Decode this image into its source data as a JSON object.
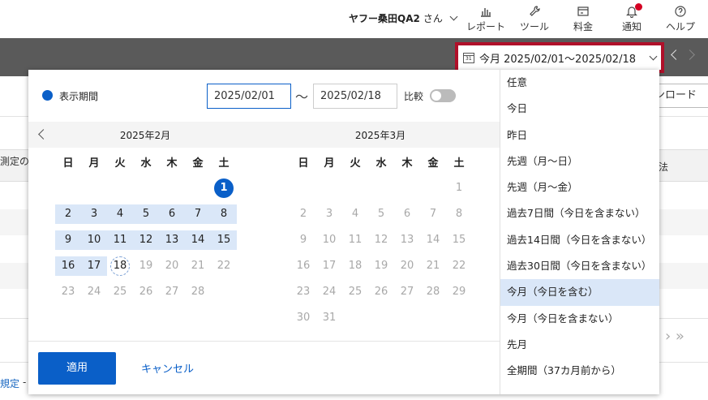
{
  "header": {
    "username": "ヤフー桑田QA2",
    "username_suffix": "さん",
    "nav": [
      {
        "label": "レポート",
        "icon": "bar-chart-icon"
      },
      {
        "label": "ツール",
        "icon": "wrench-icon"
      },
      {
        "label": "料金",
        "icon": "billing-icon"
      },
      {
        "label": "通知",
        "icon": "bell-icon"
      },
      {
        "label": "ヘルプ",
        "icon": "help-icon"
      }
    ]
  },
  "toolbar": {
    "date_range_label": "今月 2025/02/01〜2025/02/18"
  },
  "background": {
    "download_label": "ンロード",
    "column_left": "測定の時",
    "column_right": "法",
    "footer_link": "規定",
    "footer_dash": "-"
  },
  "datepicker": {
    "period_label": "表示期間",
    "start_date": "2025/02/01",
    "end_date": "2025/02/18",
    "range_separator": "〜",
    "compare_label": "比較",
    "compare_enabled": false,
    "weekdays": [
      "日",
      "月",
      "火",
      "水",
      "木",
      "金",
      "土"
    ],
    "months": [
      {
        "title": "2025年2月",
        "weeks": [
          [
            {
              "d": ""
            },
            {
              "d": ""
            },
            {
              "d": ""
            },
            {
              "d": ""
            },
            {
              "d": ""
            },
            {
              "d": ""
            },
            {
              "d": "1",
              "s": "selected"
            }
          ],
          [
            {
              "d": "2",
              "s": "inrange"
            },
            {
              "d": "3",
              "s": "inrange"
            },
            {
              "d": "4",
              "s": "inrange"
            },
            {
              "d": "5",
              "s": "inrange"
            },
            {
              "d": "6",
              "s": "inrange"
            },
            {
              "d": "7",
              "s": "inrange"
            },
            {
              "d": "8",
              "s": "inrange"
            }
          ],
          [
            {
              "d": "9",
              "s": "inrange"
            },
            {
              "d": "10",
              "s": "inrange"
            },
            {
              "d": "11",
              "s": "inrange"
            },
            {
              "d": "12",
              "s": "inrange"
            },
            {
              "d": "13",
              "s": "inrange"
            },
            {
              "d": "14",
              "s": "inrange"
            },
            {
              "d": "15",
              "s": "inrange"
            }
          ],
          [
            {
              "d": "16",
              "s": "inrange"
            },
            {
              "d": "17",
              "s": "inrange"
            },
            {
              "d": "18",
              "s": "today"
            },
            {
              "d": "19",
              "s": "muted"
            },
            {
              "d": "20",
              "s": "muted"
            },
            {
              "d": "21",
              "s": "muted"
            },
            {
              "d": "22",
              "s": "muted"
            }
          ],
          [
            {
              "d": "23",
              "s": "muted"
            },
            {
              "d": "24",
              "s": "muted"
            },
            {
              "d": "25",
              "s": "muted"
            },
            {
              "d": "26",
              "s": "muted"
            },
            {
              "d": "27",
              "s": "muted"
            },
            {
              "d": "28",
              "s": "muted"
            },
            {
              "d": ""
            }
          ]
        ]
      },
      {
        "title": "2025年3月",
        "weeks": [
          [
            {
              "d": ""
            },
            {
              "d": ""
            },
            {
              "d": ""
            },
            {
              "d": ""
            },
            {
              "d": ""
            },
            {
              "d": ""
            },
            {
              "d": "1",
              "s": "muted"
            }
          ],
          [
            {
              "d": "2",
              "s": "muted"
            },
            {
              "d": "3",
              "s": "muted"
            },
            {
              "d": "4",
              "s": "muted"
            },
            {
              "d": "5",
              "s": "muted"
            },
            {
              "d": "6",
              "s": "muted"
            },
            {
              "d": "7",
              "s": "muted"
            },
            {
              "d": "8",
              "s": "muted"
            }
          ],
          [
            {
              "d": "9",
              "s": "muted"
            },
            {
              "d": "10",
              "s": "muted"
            },
            {
              "d": "11",
              "s": "muted"
            },
            {
              "d": "12",
              "s": "muted"
            },
            {
              "d": "13",
              "s": "muted"
            },
            {
              "d": "14",
              "s": "muted"
            },
            {
              "d": "15",
              "s": "muted"
            }
          ],
          [
            {
              "d": "16",
              "s": "muted"
            },
            {
              "d": "17",
              "s": "muted"
            },
            {
              "d": "18",
              "s": "muted"
            },
            {
              "d": "19",
              "s": "muted"
            },
            {
              "d": "20",
              "s": "muted"
            },
            {
              "d": "21",
              "s": "muted"
            },
            {
              "d": "22",
              "s": "muted"
            }
          ],
          [
            {
              "d": "23",
              "s": "muted"
            },
            {
              "d": "24",
              "s": "muted"
            },
            {
              "d": "25",
              "s": "muted"
            },
            {
              "d": "26",
              "s": "muted"
            },
            {
              "d": "27",
              "s": "muted"
            },
            {
              "d": "28",
              "s": "muted"
            },
            {
              "d": "29",
              "s": "muted"
            }
          ],
          [
            {
              "d": "30",
              "s": "muted"
            },
            {
              "d": "31",
              "s": "muted"
            },
            {
              "d": ""
            },
            {
              "d": ""
            },
            {
              "d": ""
            },
            {
              "d": ""
            },
            {
              "d": ""
            }
          ]
        ]
      }
    ],
    "apply_label": "適用",
    "cancel_label": "キャンセル",
    "presets": [
      "任意",
      "今日",
      "昨日",
      "先週（月〜日）",
      "先週（月〜金）",
      "過去7日間（今日を含まない）",
      "過去14日間（今日を含まない）",
      "過去30日間（今日を含まない）",
      "今月（今日を含む）",
      "今月（今日を含まない）",
      "先月",
      "全期間（37カ月前から）"
    ],
    "active_preset_index": 8
  },
  "colors": {
    "accent": "#0a5fc8",
    "highlight_border": "#b0102a",
    "toolbar_bg": "#5a5a5a",
    "range_fill": "#dae7f8",
    "notification_dot": "#d40022"
  }
}
